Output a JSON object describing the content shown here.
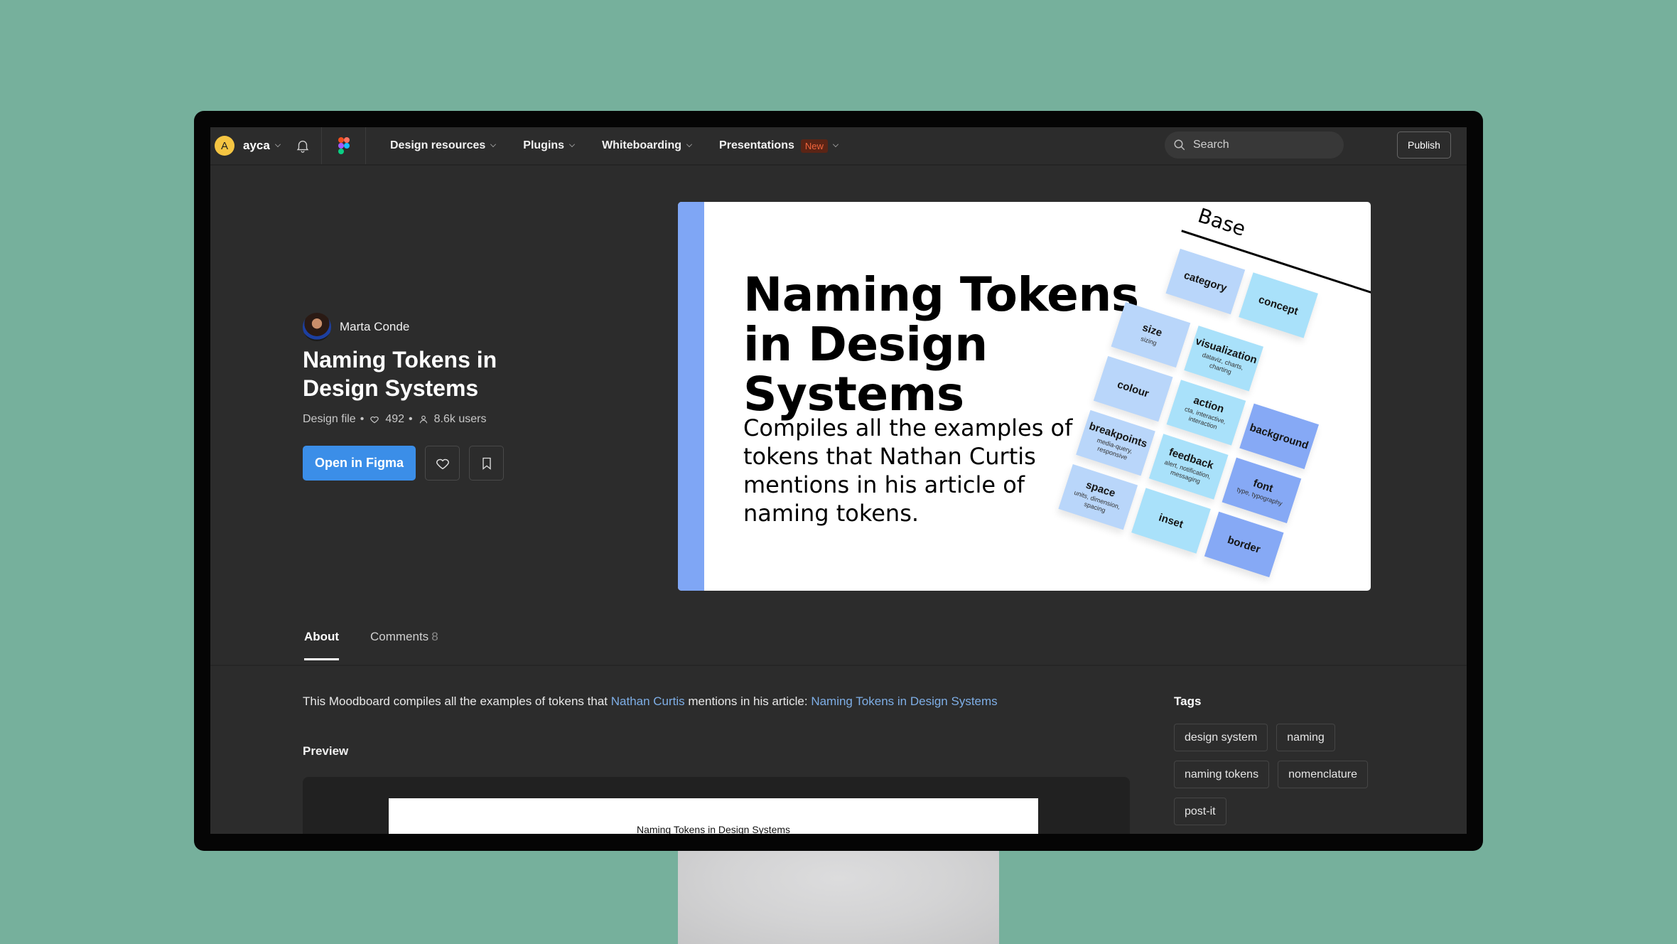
{
  "nav": {
    "user_initial": "A",
    "username": "ayca",
    "menu": [
      {
        "label": "Design resources"
      },
      {
        "label": "Plugins"
      },
      {
        "label": "Whiteboarding"
      },
      {
        "label": "Presentations",
        "badge": "New"
      }
    ],
    "search_placeholder": "Search",
    "publish_label": "Publish"
  },
  "file": {
    "author": "Marta Conde",
    "title": "Naming Tokens in Design Systems",
    "type": "Design file",
    "likes": "492",
    "users": "8.6k users",
    "open_label": "Open in Figma"
  },
  "thumbnail": {
    "title": "Naming Tokens in Design Systems",
    "subtitle": "Compiles all the examples of tokens that Nathan Curtis mentions in his article of naming tokens.",
    "base_label": "Base",
    "notes": [
      {
        "title": "category",
        "sub": ""
      },
      {
        "title": "concept",
        "sub": ""
      },
      {
        "title": "size",
        "sub": "sizing"
      },
      {
        "title": "visualization",
        "sub": "dataviz, charts, charting"
      },
      {
        "title": "colour",
        "sub": ""
      },
      {
        "title": "action",
        "sub": "cta, interactive, interaction"
      },
      {
        "title": "background",
        "sub": ""
      },
      {
        "title": "breakpoints",
        "sub": "media-query, responsive"
      },
      {
        "title": "feedback",
        "sub": "alert, notification, messaging"
      },
      {
        "title": "font",
        "sub": "type, typography"
      },
      {
        "title": "space",
        "sub": "units, dimension, spacing"
      },
      {
        "title": "inset",
        "sub": ""
      },
      {
        "title": "border",
        "sub": ""
      }
    ]
  },
  "tabs": [
    {
      "label": "About",
      "active": true
    },
    {
      "label": "Comments",
      "count": "8"
    }
  ],
  "about": {
    "text_before": "This Moodboard compiles all the examples of tokens that ",
    "link1": "Nathan Curtis",
    "text_middle": " mentions in his article: ",
    "link2": "Naming Tokens in Design Systems",
    "preview_heading": "Preview",
    "preview_title": "Naming Tokens in Design Systems"
  },
  "tags": {
    "heading": "Tags",
    "items": [
      "design system",
      "naming",
      "naming tokens",
      "nomenclature",
      "post-it"
    ]
  }
}
